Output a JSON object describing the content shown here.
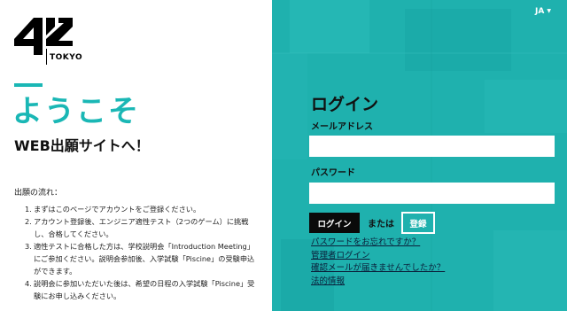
{
  "brand": {
    "logo_mark": "42",
    "logo_sub": "TOKYO"
  },
  "hero": {
    "welcome": "ようこそ",
    "subtitle": "WEB出願サイトへ！"
  },
  "flow": {
    "title": "出願の流れ：",
    "steps": [
      {
        "num": "1.",
        "text": "まずはこのページでアカウントをご登録ください。"
      },
      {
        "num": "2.",
        "text": "アカウント登録後、エンジニア適性テスト（2つのゲーム）に挑戦し、合格してください。"
      },
      {
        "num": "3.",
        "text": "適性テストに合格した方は、学校説明会「Introduction Meeting」にご参加ください。説明会参加後、入学試験「Piscine」の受験申込ができます。"
      },
      {
        "num": "4.",
        "text": "説明会に参加いただいた後は、希望の日程の入学試験「Piscine」受験にお申し込みください。"
      }
    ]
  },
  "header": {
    "language": "JA"
  },
  "login": {
    "title": "ログイン",
    "email_label": "メールアドレス",
    "email_value": "",
    "password_label": "パスワード",
    "password_value": "",
    "login_button": "ログイン",
    "or_text": "または",
    "register_button": "登録"
  },
  "links": {
    "forgot_password": "パスワードをお忘れですか？",
    "admin_login": "管理者ログイン",
    "no_confirmation": "確認メールが届きませんでしたか？",
    "legal": "法的情報"
  },
  "colors": {
    "accent": "#1ab7b5",
    "panel": "#1fb1ae",
    "button_dark": "#0a0a0a"
  }
}
